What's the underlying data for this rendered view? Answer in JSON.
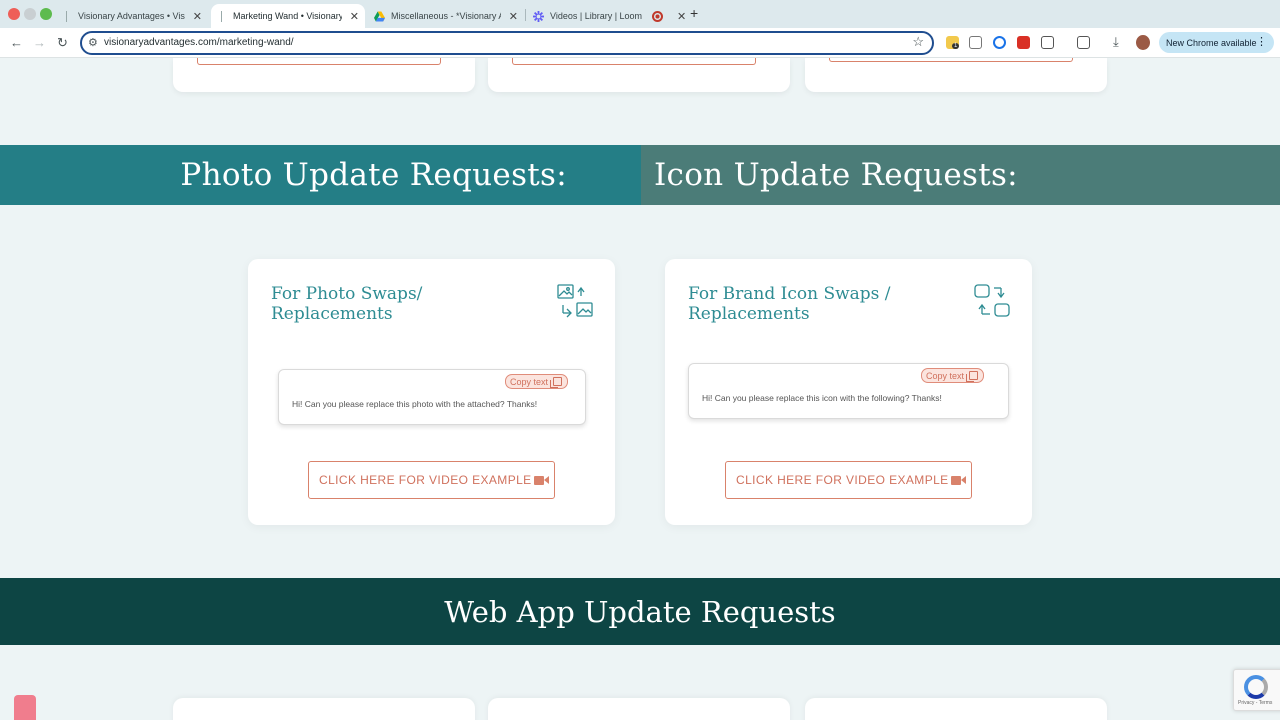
{
  "browser": {
    "tabs": [
      {
        "label": "Visionary Advantages • Visio",
        "active": false
      },
      {
        "label": "Marketing Wand • Visionary A",
        "active": true
      },
      {
        "label": "Miscellaneous - *Visionary A",
        "active": false
      },
      {
        "label": "Videos | Library | Loom",
        "active": false
      }
    ],
    "url": "visionaryadvantages.com/marketing-wand/",
    "new_chrome_label": "New Chrome available",
    "extension_badge": "1"
  },
  "sections": {
    "photo_heading": "Photo Update Requests:",
    "icon_heading": "Icon Update Requests:",
    "web_app_heading": "Web App Update Requests"
  },
  "cards": {
    "photo": {
      "title": "For Photo Swaps/ Replacements",
      "copy_label": "Copy text",
      "message": "Hi! Can you please replace this photo with the attached? Thanks!",
      "video_label": "CLICK HERE FOR VIDEO EXAMPLE",
      "icon": "image-swap-icon"
    },
    "brand_icon": {
      "title": "For Brand Icon Swaps / Replacements",
      "copy_label": "Copy text",
      "message": "Hi! Can you please replace this icon with the following? Thanks!",
      "video_label": "CLICK HERE FOR VIDEO EXAMPLE",
      "icon": "shape-swap-icon"
    }
  },
  "recaptcha": {
    "text": "Privacy - Terms"
  },
  "colors": {
    "teal_banner": "#247e86",
    "slate_banner": "#4b7c78",
    "dark_banner": "#0d4544",
    "heading_teal": "#2e8c93",
    "accent_coral": "#d0715d"
  }
}
